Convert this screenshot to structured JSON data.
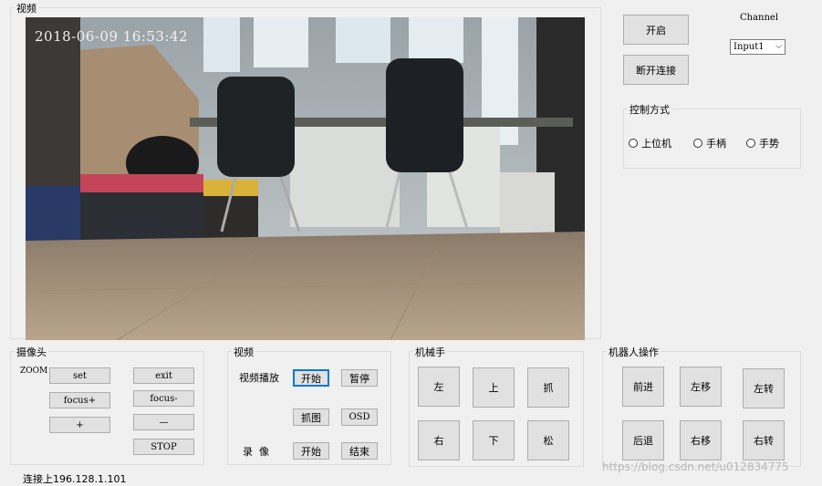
{
  "video_group": {
    "label": "视频",
    "timestamp": "2018-06-09 16:53:42"
  },
  "top_controls": {
    "open_label": "开启",
    "disconnect_label": "断开连接",
    "channel_label": "Channel",
    "channel_value": "Input1"
  },
  "control_mode": {
    "label": "控制方式",
    "options": [
      "上位机",
      "手柄",
      "手势"
    ]
  },
  "camera_group": {
    "label": "摄像头",
    "zoom_label": "ZOOM",
    "set_label": "set",
    "exit_label": "exit",
    "focus_plus_label": "focus+",
    "focus_minus_label": "focus-",
    "plus_label": "+",
    "minus_label": "—",
    "stop_label": "STOP"
  },
  "video_ctrl_group": {
    "label": "视频",
    "playback_label": "视频播放",
    "start_label": "开始",
    "pause_label": "暂停",
    "capture_label": "抓图",
    "osd_label": "OSD",
    "record_label": "录  像",
    "rec_start_label": "开始",
    "rec_end_label": "结束"
  },
  "arm_group": {
    "label": "机械手",
    "left": "左",
    "up": "上",
    "grab": "抓",
    "right": "右",
    "down": "下",
    "release": "松"
  },
  "robot_group": {
    "label": "机器人操作",
    "forward": "前进",
    "move_left": "左移",
    "turn_left": "左转",
    "back": "后退",
    "move_right": "右移",
    "turn_right": "右转"
  },
  "status": {
    "text": "连接上196.128.1.101"
  },
  "watermark": "https://blog.csdn.net/u012834775"
}
